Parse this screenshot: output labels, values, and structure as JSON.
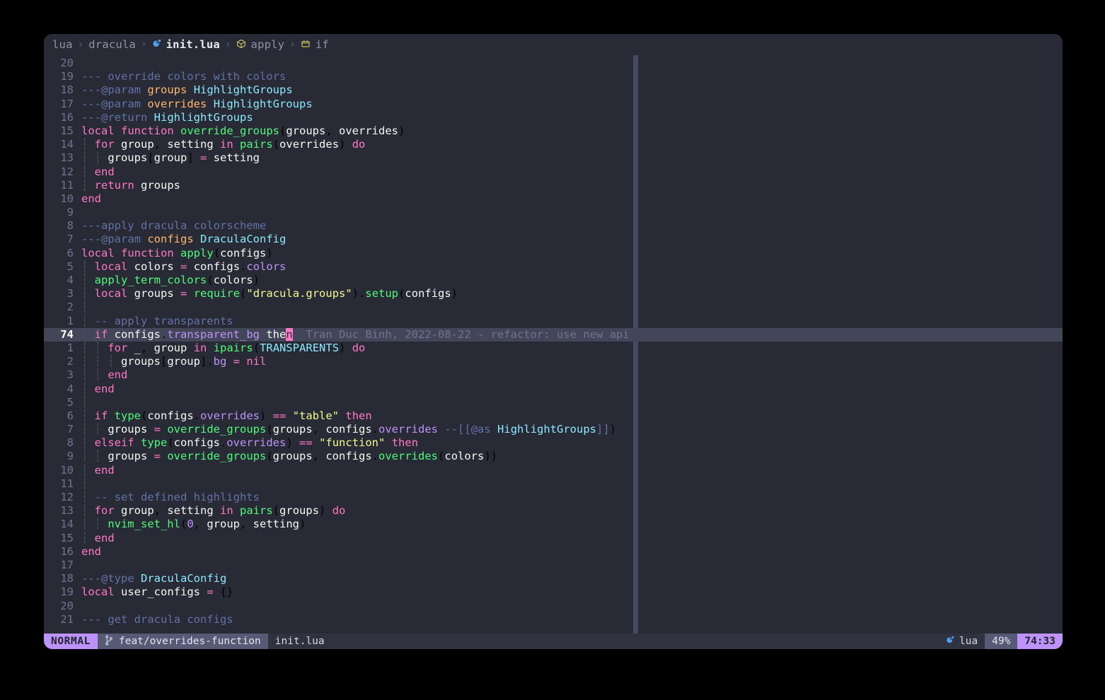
{
  "window": {
    "background": "#282a36",
    "page_background": "#000000"
  },
  "breadcrumb": {
    "items": [
      {
        "label": "lua",
        "icon": null,
        "kind": "dir"
      },
      {
        "label": "dracula",
        "icon": null,
        "kind": "dir"
      },
      {
        "label": "init.lua",
        "icon": "lua-icon",
        "kind": "file"
      },
      {
        "label": "apply",
        "icon": "function-icon",
        "kind": "symbol"
      },
      {
        "label": "if",
        "icon": "block-icon",
        "kind": "symbol"
      }
    ],
    "separator": "›"
  },
  "editor": {
    "cursor_line_number": "74",
    "cursor_position": "74:33",
    "blame_annotation": "Tran Duc Binh, 2022-08-22 - refactor: use new api",
    "lines": [
      {
        "num": "20",
        "indent": 0,
        "text": ""
      },
      {
        "num": "19",
        "indent": 0,
        "text": "--- override colors with colors"
      },
      {
        "num": "18",
        "indent": 0,
        "text": "---@param groups HighlightGroups"
      },
      {
        "num": "17",
        "indent": 0,
        "text": "---@param overrides HighlightGroups"
      },
      {
        "num": "16",
        "indent": 0,
        "text": "---@return HighlightGroups"
      },
      {
        "num": "15",
        "indent": 0,
        "text": "local function override_groups(groups, overrides)"
      },
      {
        "num": "14",
        "indent": 1,
        "text": "for group, setting in pairs(overrides) do"
      },
      {
        "num": "13",
        "indent": 2,
        "text": "groups[group] = setting"
      },
      {
        "num": "12",
        "indent": 1,
        "text": "end"
      },
      {
        "num": "11",
        "indent": 1,
        "text": "return groups"
      },
      {
        "num": "10",
        "indent": 0,
        "text": "end"
      },
      {
        "num": "9",
        "indent": 0,
        "text": ""
      },
      {
        "num": "8",
        "indent": 0,
        "text": "---apply dracula colorscheme"
      },
      {
        "num": "7",
        "indent": 0,
        "text": "---@param configs DraculaConfig"
      },
      {
        "num": "6",
        "indent": 0,
        "text": "local function apply(configs)"
      },
      {
        "num": "5",
        "indent": 1,
        "text": "local colors = configs.colors"
      },
      {
        "num": "4",
        "indent": 1,
        "text": "apply_term_colors(colors)"
      },
      {
        "num": "3",
        "indent": 1,
        "text": "local groups = require(\"dracula.groups\").setup(configs)"
      },
      {
        "num": "2",
        "indent": 1,
        "text": ""
      },
      {
        "num": "1",
        "indent": 1,
        "text": "-- apply transparents"
      },
      {
        "num": "74",
        "indent": 1,
        "text": "if configs.transparent_bg then",
        "current": true
      },
      {
        "num": "1",
        "indent": 2,
        "text": "for _, group in ipairs(TRANSPARENTS) do"
      },
      {
        "num": "2",
        "indent": 3,
        "text": "groups[group].bg = nil"
      },
      {
        "num": "3",
        "indent": 2,
        "text": "end"
      },
      {
        "num": "4",
        "indent": 1,
        "text": "end"
      },
      {
        "num": "5",
        "indent": 1,
        "text": ""
      },
      {
        "num": "6",
        "indent": 1,
        "text": "if type(configs.overrides) == \"table\" then"
      },
      {
        "num": "7",
        "indent": 2,
        "text": "groups = override_groups(groups, configs.overrides --[[@as HighlightGroups]])"
      },
      {
        "num": "8",
        "indent": 1,
        "text": "elseif type(configs.overrides) == \"function\" then"
      },
      {
        "num": "9",
        "indent": 2,
        "text": "groups = override_groups(groups, configs.overrides(colors))"
      },
      {
        "num": "10",
        "indent": 1,
        "text": "end"
      },
      {
        "num": "11",
        "indent": 1,
        "text": ""
      },
      {
        "num": "12",
        "indent": 1,
        "text": "-- set defined highlights"
      },
      {
        "num": "13",
        "indent": 1,
        "text": "for group, setting in pairs(groups) do"
      },
      {
        "num": "14",
        "indent": 2,
        "text": "nvim_set_hl(0, group, setting)"
      },
      {
        "num": "15",
        "indent": 1,
        "text": "end"
      },
      {
        "num": "16",
        "indent": 0,
        "text": "end"
      },
      {
        "num": "17",
        "indent": 0,
        "text": ""
      },
      {
        "num": "18",
        "indent": 0,
        "text": "---@type DraculaConfig"
      },
      {
        "num": "19",
        "indent": 0,
        "text": "local user_configs = {}"
      },
      {
        "num": "20",
        "indent": 0,
        "text": ""
      },
      {
        "num": "21",
        "indent": 0,
        "text": "--- get dracula configs"
      }
    ]
  },
  "statusline": {
    "mode": "NORMAL",
    "branch_icon": "git-branch-icon",
    "branch": "feat/overrides-function",
    "filename": "init.lua",
    "filetype_icon": "lua-icon",
    "filetype": "lua",
    "scroll_percent": "49%",
    "position": "74:33"
  },
  "colors": {
    "accent_purple": "#bd93f9",
    "pink": "#ff79c6",
    "green": "#50fa7b",
    "cyan": "#8be9fd",
    "orange": "#ffb86c",
    "yellow": "#f1fa8c",
    "comment": "#6272a4",
    "foreground": "#f8f8f2",
    "background": "#282a36",
    "cursorline": "#434659",
    "statusline_bg": "#30323f",
    "branch_bg": "#565a75"
  }
}
